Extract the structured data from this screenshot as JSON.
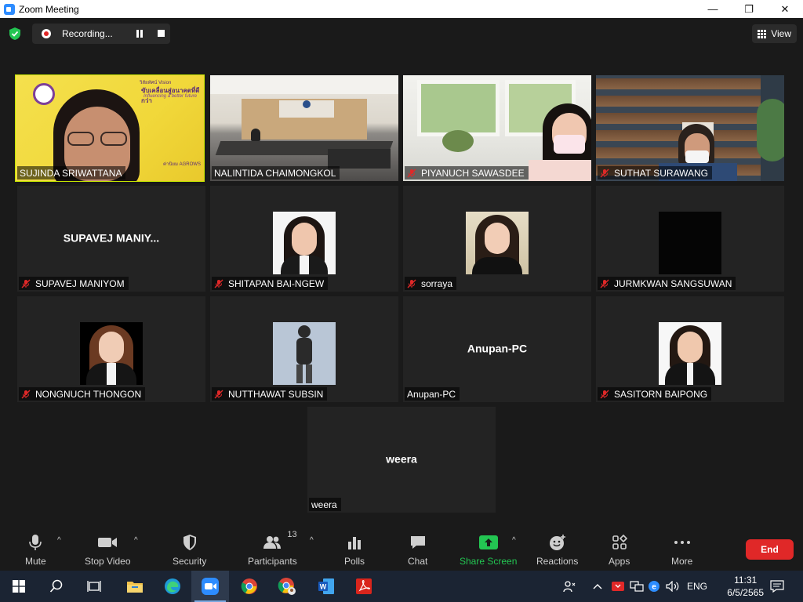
{
  "window": {
    "title": "Zoom Meeting",
    "minimize": "—",
    "maximize": "❐",
    "close": "✕"
  },
  "meeting": {
    "recording_label": "Recording...",
    "view_label": "View"
  },
  "tiles": [
    {
      "name": "SUJINDA SRIWATTANA",
      "muted": false,
      "active": true
    },
    {
      "name": "NALINTIDA CHAIMONGKOL",
      "muted": false
    },
    {
      "name": "PIYANUCH SAWASDEE",
      "muted": true
    },
    {
      "name": "SUTHAT SURAWANG",
      "muted": true
    },
    {
      "name": "SUPAVEJ MANIYOM",
      "muted": true,
      "center": "SUPAVEJ  MANIY..."
    },
    {
      "name": "SHITAPAN BAI-NGEW",
      "muted": true
    },
    {
      "name": "sorraya",
      "muted": true
    },
    {
      "name": "JURMKWAN SANGSUWAN",
      "muted": true
    },
    {
      "name": "NONGNUCH THONGON",
      "muted": true
    },
    {
      "name": "NUTTHAWAT SUBSIN",
      "muted": true
    },
    {
      "name": "Anupan-PC",
      "muted": false,
      "center": "Anupan-PC"
    },
    {
      "name": "SASITORN BAIPONG",
      "muted": true
    },
    {
      "name": "weera",
      "muted": false,
      "center": "weera"
    }
  ],
  "tile1_banner": {
    "line1": "วิสัยทัศน์ Vision",
    "line2": "ขับเคลื่อนสู่อนาคตที่ดีกว่า",
    "line3": "Influencing a better future",
    "line4": "ค่านิยม AGROWS"
  },
  "toolbar": {
    "mute": "Mute",
    "stop_video": "Stop Video",
    "security": "Security",
    "participants": "Participants",
    "participants_count": "13",
    "polls": "Polls",
    "chat": "Chat",
    "share_screen": "Share Screen",
    "reactions": "Reactions",
    "apps": "Apps",
    "more": "More",
    "end": "End"
  },
  "taskbar": {
    "language": "ENG",
    "time": "11:31",
    "date": "6/5/2565"
  },
  "colors": {
    "active_speaker": "#c4e500",
    "end_button": "#e02828",
    "share_green": "#23c552",
    "muted_red": "#e02828"
  }
}
